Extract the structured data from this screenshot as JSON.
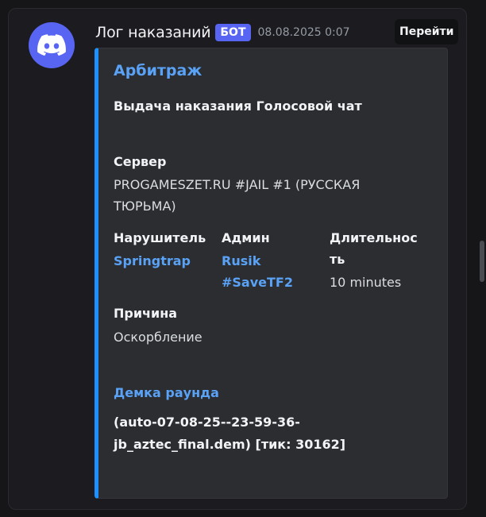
{
  "message": {
    "author_name": "Лог наказаний",
    "bot_badge": "БОТ",
    "timestamp": "08.08.2025 0:07",
    "goto_label": "Перейти",
    "avatar_icon": "discord-logo-icon"
  },
  "embed": {
    "accent_color": "#1e90ff",
    "author": "Арбитраж",
    "title": "Выдача наказания Голосовой чат",
    "server": {
      "name": "Сервер",
      "value_line1": "PROGAMESZET.RU #JAIL #1 (РУССКАЯ",
      "value_line2": "ТЮРЬМА)"
    },
    "violator": {
      "name": "Нарушитель",
      "value": "Springtrap"
    },
    "admin": {
      "name": "Админ",
      "value_line1": "Rusik",
      "value_line2": "#SaveTF2"
    },
    "duration": {
      "name_line1": "Длительнос",
      "name_line2": "ть",
      "value": "10 minutes"
    },
    "reason": {
      "name": "Причина",
      "value": "Оскорбление"
    },
    "demo": {
      "name": "Демка раунда",
      "value_line1": "(auto-07-08-25--23-59-36-",
      "value_line2": "jb_aztec_final.dem) [тик: 30162]"
    }
  },
  "colors": {
    "background": "#161618",
    "panel": "#1c1c20",
    "embed_bg": "#2b2d31",
    "link": "#5aa2f5",
    "blurple": "#5865f2"
  }
}
